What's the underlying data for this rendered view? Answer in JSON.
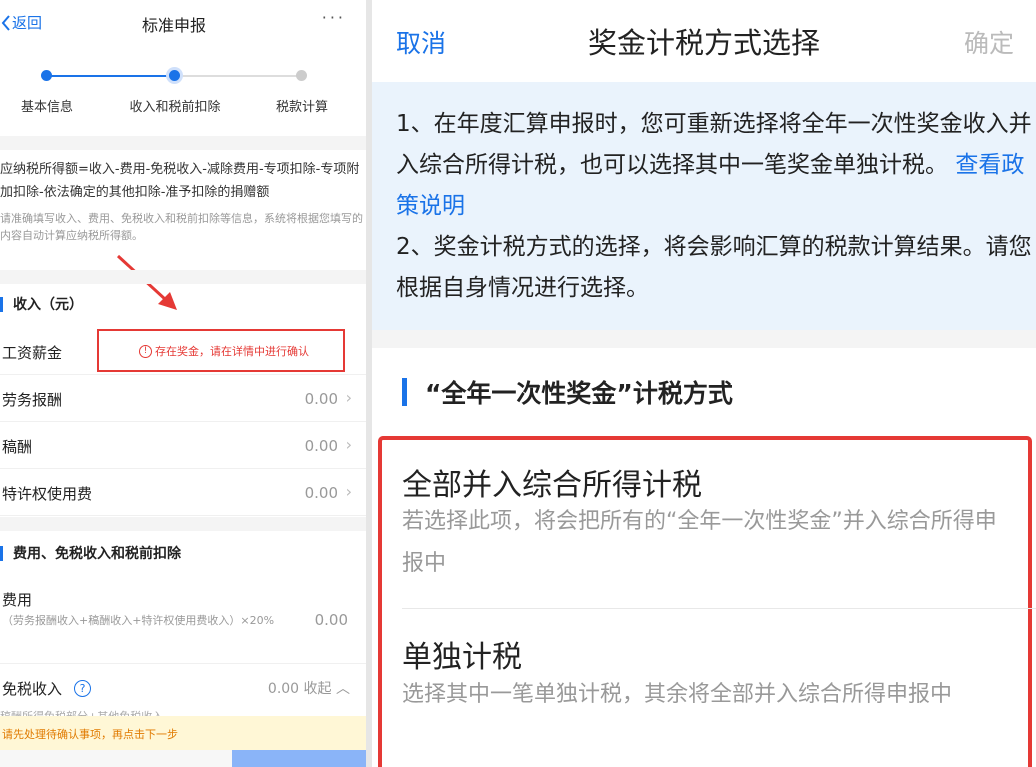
{
  "left": {
    "header": {
      "back_label": "返回",
      "title": "标准申报",
      "more": "···"
    },
    "steps": [
      {
        "label": "基本信息",
        "state": "done"
      },
      {
        "label": "收入和税前扣除",
        "state": "current"
      },
      {
        "label": "税款计算",
        "state": "todo"
      }
    ],
    "formula": "应纳税所得额=收入-费用-免税收入-减除费用-专项扣除-专项附加扣除-依法确定的其他扣除-准予扣除的捐赠额",
    "hint": "请准确填写收入、费用、免税收入和税前扣除等信息，系统将根据您填写的内容自动计算应纳税所得额。",
    "income_section": "收入（元）",
    "income_rows": [
      {
        "label": "工资薪金",
        "value": ""
      },
      {
        "label": "劳务报酬",
        "value": "0.00"
      },
      {
        "label": "稿酬",
        "value": "0.00"
      },
      {
        "label": "特许权使用费",
        "value": "0.00"
      }
    ],
    "salary_warning": "存在奖金，请在详情中进行确认",
    "deduction_section": "费用、免税收入和税前扣除",
    "fee": {
      "label": "费用",
      "sub": "（劳务报酬收入+稿酬收入+特许权使用费收入）×20%",
      "value": "0.00"
    },
    "tax_free": {
      "label": "免税收入",
      "value": "0.00 收起"
    },
    "cut_line": "稿酬所得免税部分+其他免税收入",
    "warning_bar": "请先处理待确认事项，再点击下一步",
    "colors": {
      "accent": "#1a73e8",
      "alert": "#e53935",
      "warning_bg": "#fff7d6"
    }
  },
  "right": {
    "header": {
      "cancel": "取消",
      "title": "奖金计税方式选择",
      "confirm": "确定"
    },
    "notice": {
      "p1": "1、在年度汇算申报时，您可重新选择将全年一次性奖金收入并入综合所得计税，也可以选择其中一笔奖金单独计税。",
      "policy_link": "查看政策说明",
      "p2": "2、奖金计税方式的选择，将会影响汇算的税款计算结果。请您根据自身情况进行选择。"
    },
    "section_title": "“全年一次性奖金”计税方式",
    "options": [
      {
        "title": "全部并入综合所得计税",
        "desc": "若选择此项，将会把所有的“全年一次性奖金”并入综合所得申报中"
      },
      {
        "title": "单独计税",
        "desc": "选择其中一笔单独计税，其余将全部并入综合所得申报中"
      }
    ],
    "colors": {
      "accent": "#1a73e8",
      "highlight": "#e53935",
      "notice_bg": "#eaf3fc"
    }
  }
}
